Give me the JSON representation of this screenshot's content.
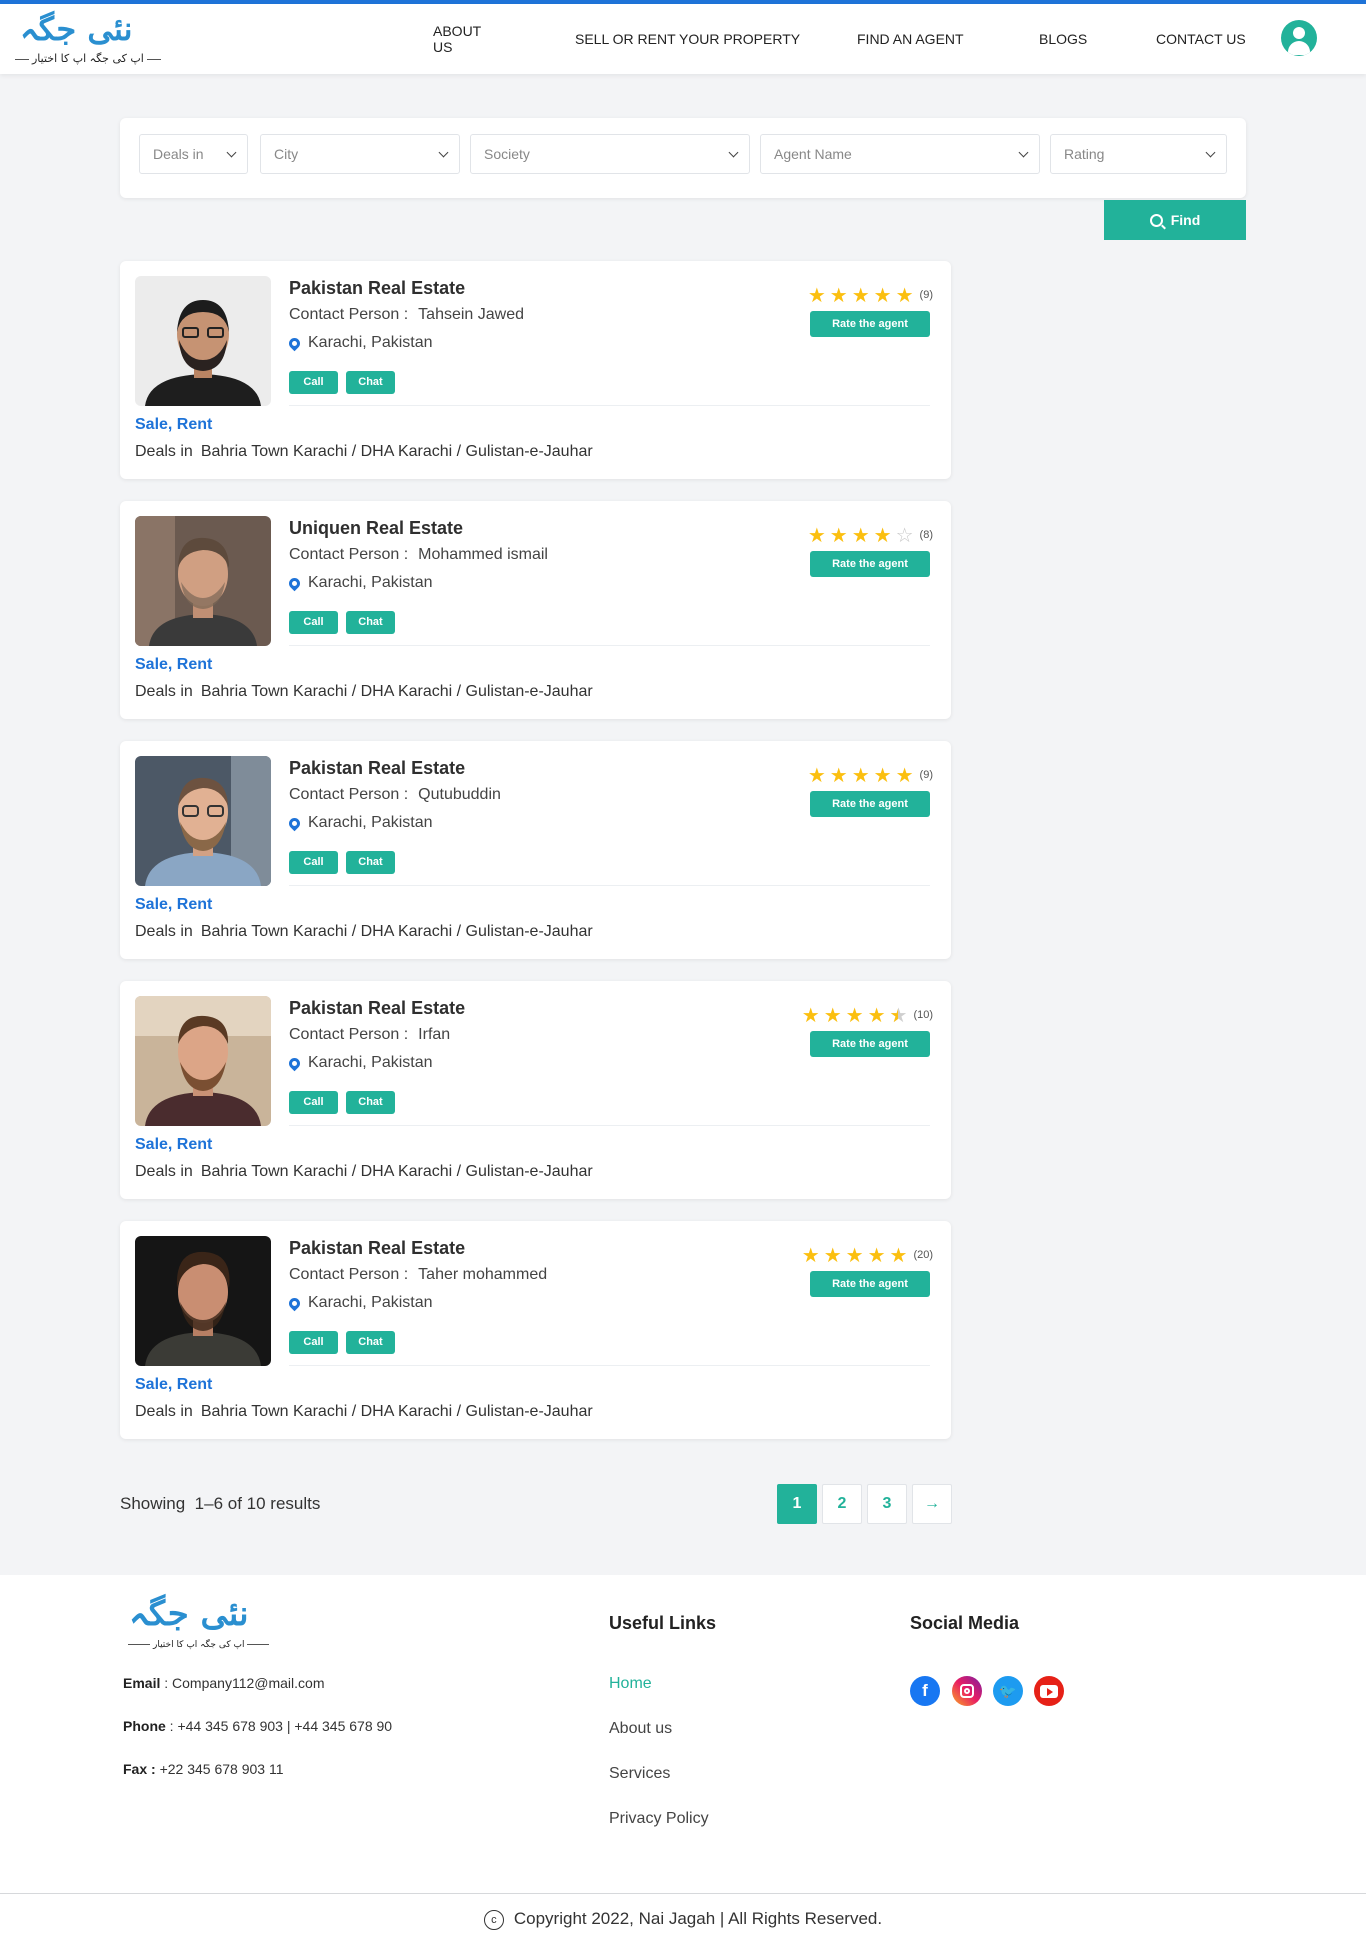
{
  "logo": {
    "name": "نئی جگہ",
    "tagline": "اپ کی جگہ اپ کا اختیار"
  },
  "nav": {
    "about": "ABOUT US",
    "sell": "SELL OR RENT YOUR PROPERTY",
    "agent": "FIND AN AGENT",
    "blogs": "BLOGS",
    "contact": "CONTACT US",
    "user_icon": "user-circle-icon"
  },
  "filters": {
    "deals": "Deals in",
    "city": "City",
    "society": "Society",
    "agent_name": "Agent Name",
    "rating": "Rating",
    "find": "Find"
  },
  "agents": [
    {
      "agency": "Pakistan Real Estate",
      "contact_label": "Contact Person :",
      "contact": "Tahsein Jawed",
      "location": "Karachi, Pakistan",
      "call": "Call",
      "chat": "Chat",
      "rating": 5,
      "reviews": "(9)",
      "rate_label": "Rate the agent",
      "types": "Sale, Rent",
      "deals_label": "Deals in",
      "deals": "Bahria Town Karachi / DHA Karachi / Gulistan-e-Jauhar"
    },
    {
      "agency": "Uniquen Real Estate",
      "contact_label": "Contact Person :",
      "contact": "Mohammed ismail",
      "location": "Karachi, Pakistan",
      "call": "Call",
      "chat": "Chat",
      "rating": 4,
      "reviews": "(8)",
      "rate_label": "Rate the agent",
      "types": "Sale, Rent",
      "deals_label": "Deals in",
      "deals": "Bahria Town Karachi / DHA Karachi / Gulistan-e-Jauhar"
    },
    {
      "agency": "Pakistan Real Estate",
      "contact_label": "Contact Person :",
      "contact": "Qutubuddin",
      "location": "Karachi, Pakistan",
      "call": "Call",
      "chat": "Chat",
      "rating": 5,
      "reviews": "(9)",
      "rate_label": "Rate the agent",
      "types": "Sale, Rent",
      "deals_label": "Deals in",
      "deals": "Bahria Town Karachi / DHA Karachi / Gulistan-e-Jauhar"
    },
    {
      "agency": "Pakistan Real Estate",
      "contact_label": "Contact Person :",
      "contact": "Irfan",
      "location": "Karachi, Pakistan",
      "call": "Call",
      "chat": "Chat",
      "rating": 4.5,
      "reviews": "(10)",
      "rate_label": "Rate the agent",
      "types": "Sale, Rent",
      "deals_label": "Deals in",
      "deals": "Bahria Town Karachi / DHA Karachi / Gulistan-e-Jauhar"
    },
    {
      "agency": "Pakistan Real Estate",
      "contact_label": "Contact Person :",
      "contact": "Taher mohammed",
      "location": "Karachi, Pakistan",
      "call": "Call",
      "chat": "Chat",
      "rating": 5,
      "reviews": "(20)",
      "rate_label": "Rate the agent",
      "types": "Sale, Rent",
      "deals_label": "Deals in",
      "deals": "Bahria Town Karachi / DHA Karachi / Gulistan-e-Jauhar"
    }
  ],
  "pagination": {
    "showing_label": "Showing",
    "showing_range": "1–6 of 10 results",
    "pages": [
      "1",
      "2",
      "3"
    ],
    "next": "→"
  },
  "footer": {
    "email_label": "Email",
    "email": "Company112@mail.com",
    "phone_label": "Phone",
    "phone": "+44 345 678 903  |  +44 345 678 90",
    "fax_label": "Fax :",
    "fax": "+22 345 678 903 11",
    "useful_links_title": "Useful Links",
    "links": [
      "Home",
      "About us",
      "Services",
      "Privacy Policy"
    ],
    "social_title": "Social Media",
    "social": [
      "facebook-icon",
      "instagram-icon",
      "twitter-icon",
      "youtube-icon"
    ],
    "copyright": "Copyright  2022, Nai Jagah |  All Rights Reserved."
  },
  "colors": {
    "accent": "#22b29a",
    "link": "#1e73d8",
    "star": "#fbbf10"
  }
}
